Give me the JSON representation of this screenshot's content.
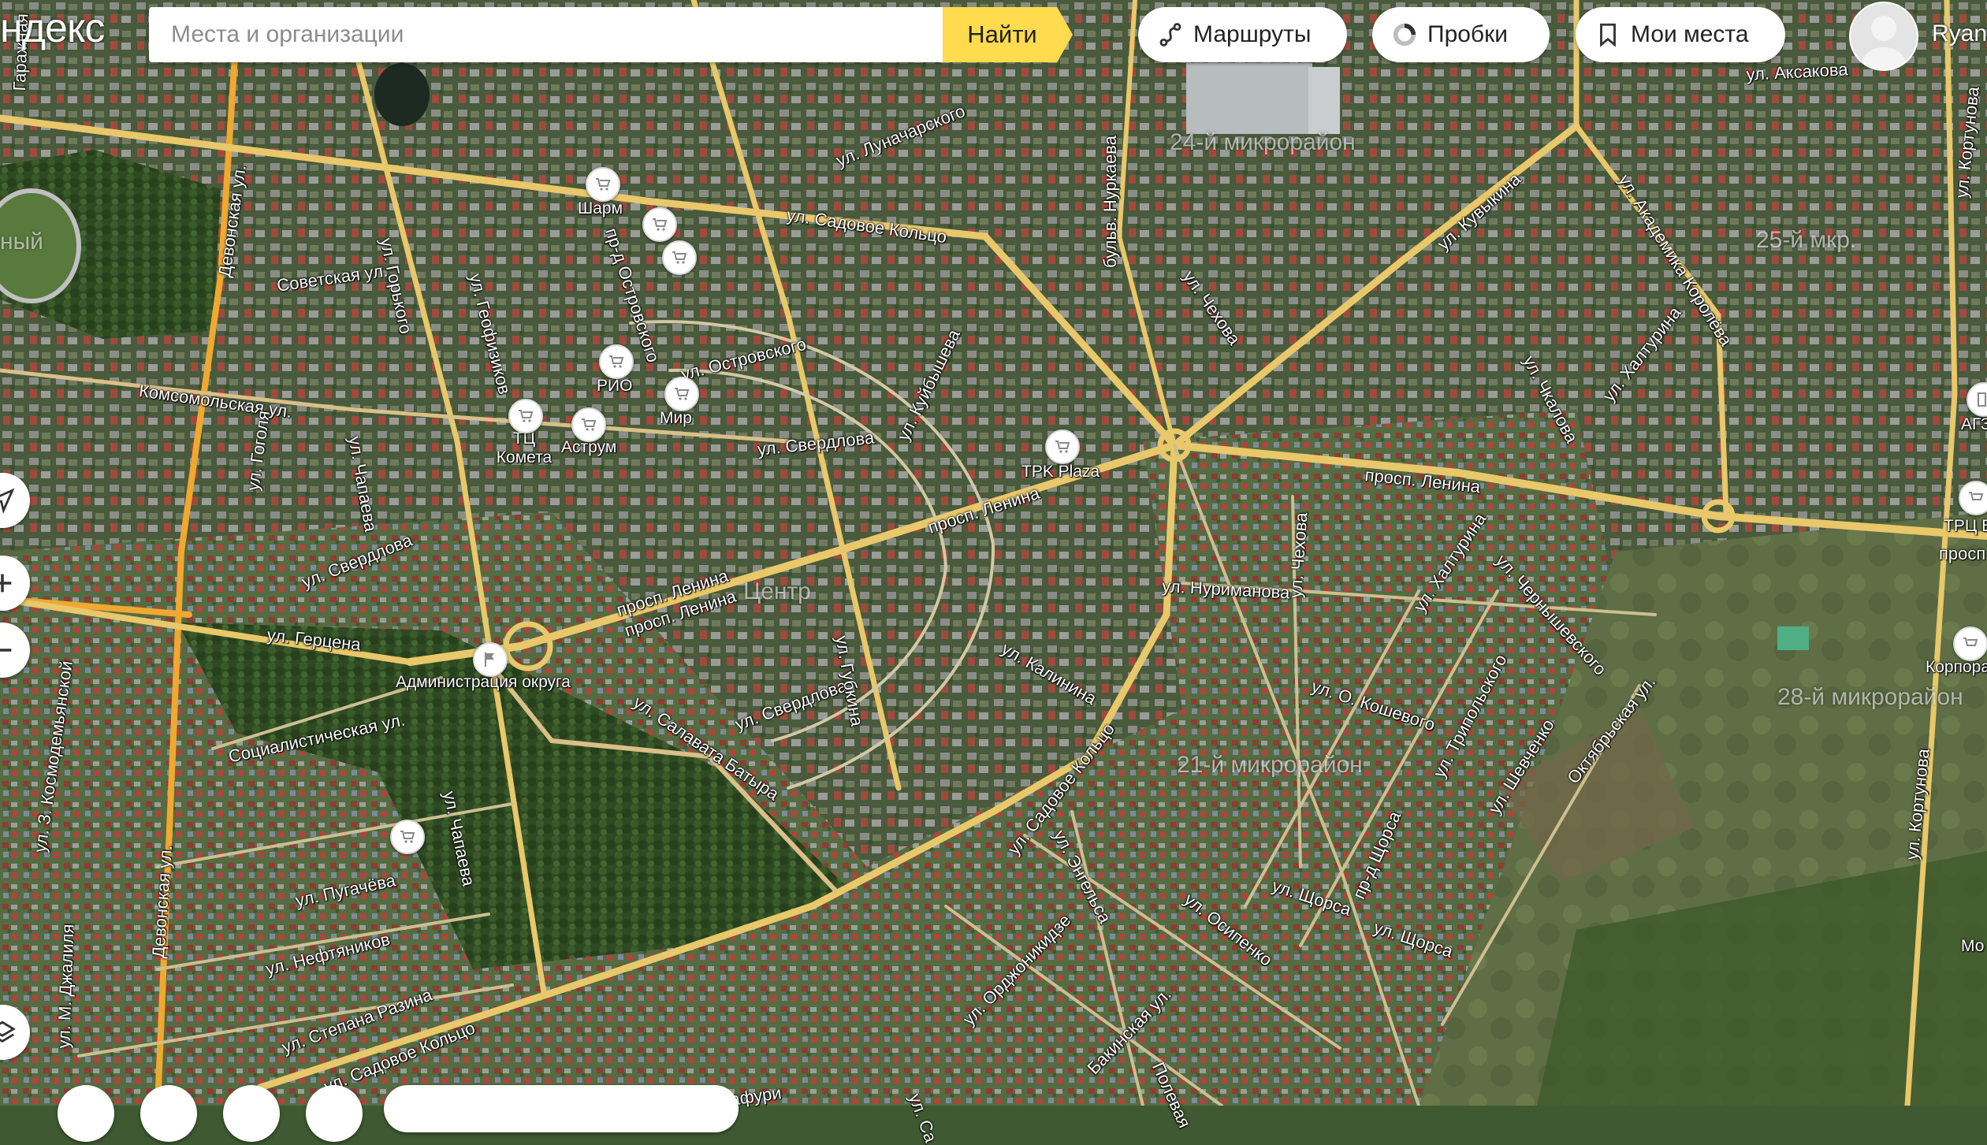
{
  "brand": {
    "text": "ндекс"
  },
  "search": {
    "placeholder": "Места и организации",
    "button_label": "Найти"
  },
  "toolbar": {
    "routes_label": "Маршруты",
    "traffic_label": "Пробки",
    "places_label": "Мои места"
  },
  "user": {
    "name": "Ryan"
  },
  "colors": {
    "accent": "#ffdb4d",
    "road": "#e8c86a",
    "arterial": "#f0a830"
  },
  "districts": [
    "24-й микрорайон",
    "25-й мкр.",
    "28-й микрорайон",
    "21-й микрорайон",
    "Центр",
    "ный"
  ],
  "streets": [
    "ул. Аксакова",
    "ул. Луначарского",
    "ул. Садовое Кольцо",
    "бульв. Нуркаева",
    "ул. Кувыкина",
    "ул. Академика Королёва",
    "ул. Кортунова",
    "Девонская ул.",
    "Советская ул.",
    "ул. Горького",
    "ул. Геофизиков",
    "пр-д Островского",
    "ул. Островского",
    "Комсомольская ул.",
    "ул. Куйбышева",
    "ул. Чехова",
    "ул. Чкалова",
    "ул. Халтурина",
    "ул. Свердлова",
    "ул. Чапаева",
    "ул. Гоголя",
    "просп. Ленина",
    "ул. Герцена",
    "ул. Нуриманова",
    "ул. Калинина",
    "ул. Губкина",
    "ул. Чернышевского",
    "ул. Салавата Батыра",
    "Социалистическая ул.",
    "ул. О. Кошевого",
    "ул. Трипольского",
    "Октябрьская ул.",
    "ул. Шевченко",
    "ул. Энгельса",
    "ул. Пугачёва",
    "ул. Нефтяников",
    "ул. Степана Разина",
    "ул. Осипенко",
    "ул. Щорса",
    "пр-д Щорса",
    "ул. Орджоникидзе",
    "Бакинская ул.",
    "Полевая",
    "ул. З. Космодемьянской",
    "ул. М. Джалиля",
    "ул. Са",
    "Гаражная",
    "афури",
    "просп"
  ],
  "pois": [
    "Шарм",
    "РИО",
    "Мир",
    "ТЦ Комета",
    "Аструм",
    "TPK Plaza",
    "Администрация округа",
    "АГЗ",
    "ТРЦ В",
    "Корпорация",
    "Мо"
  ]
}
